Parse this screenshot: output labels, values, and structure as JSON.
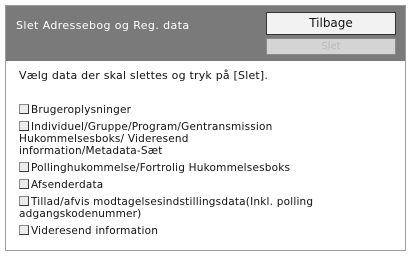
{
  "header": {
    "title": "Slet Adressebog og Reg. data",
    "back_label": "Tilbage",
    "delete_label": "Slet"
  },
  "instruction": "Vælg data der skal slettes og tryk på [Slet].",
  "options": [
    {
      "lines": [
        "Brugeroplysninger"
      ],
      "checked": false
    },
    {
      "lines": [
        "Individuel/Gruppe/Program/Gentransmission",
        "Hukommelsesboks/ Videresend",
        "information/Metadata-Sæt"
      ],
      "checked": false
    },
    {
      "lines": [
        "Pollinghukommelse/Fortrolig Hukommelsesboks"
      ],
      "checked": false
    },
    {
      "lines": [
        "Afsenderdata"
      ],
      "checked": false
    },
    {
      "lines": [
        "Tillad/afvis modtagelsesindstillingsdata(Inkl. polling",
        "adgangskodenummer)"
      ],
      "checked": false
    },
    {
      "lines": [
        "Videresend information"
      ],
      "checked": false
    }
  ]
}
